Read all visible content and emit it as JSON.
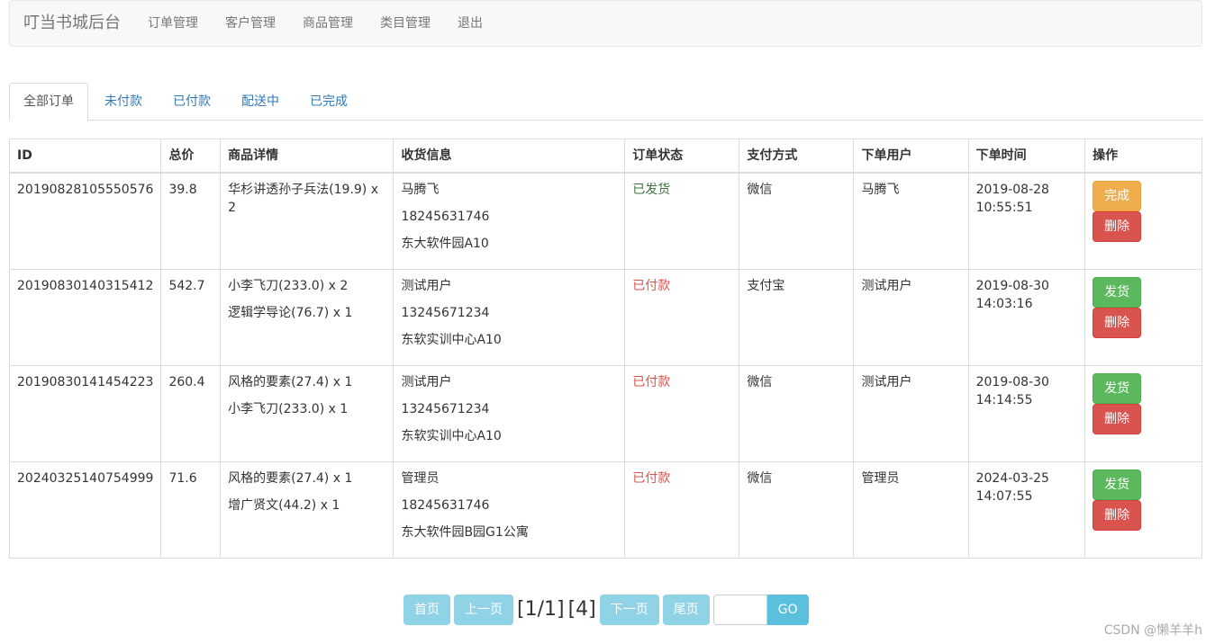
{
  "navbar": {
    "brand": "叮当书城后台",
    "links": [
      "订单管理",
      "客户管理",
      "商品管理",
      "类目管理",
      "退出"
    ]
  },
  "tabs": [
    "全部订单",
    "未付款",
    "已付款",
    "配送中",
    "已完成"
  ],
  "table": {
    "headers": [
      "ID",
      "总价",
      "商品详情",
      "收货信息",
      "订单状态",
      "支付方式",
      "下单用户",
      "下单时间",
      "操作"
    ],
    "rows": [
      {
        "id": "20190828105550576",
        "total": "39.8",
        "items": [
          "华杉讲透孙子兵法(19.9) x 2"
        ],
        "address": [
          "马腾飞",
          "18245631746",
          "东大软件园A10"
        ],
        "status": "已发货",
        "payment": "微信",
        "user": "马腾飞",
        "time": [
          "2019-08-28",
          "10:55:51"
        ],
        "action": "完成",
        "delete": "删除"
      },
      {
        "id": "20190830140315412",
        "total": "542.7",
        "items": [
          "小李飞刀(233.0) x 2",
          "逻辑学导论(76.7) x 1"
        ],
        "address": [
          "测试用户",
          "13245671234",
          "东软实训中心A10"
        ],
        "status": "已付款",
        "payment": "支付宝",
        "user": "测试用户",
        "time": [
          "2019-08-30",
          "14:03:16"
        ],
        "action": "发货",
        "delete": "删除"
      },
      {
        "id": "20190830141454223",
        "total": "260.4",
        "items": [
          "风格的要素(27.4) x 1",
          "小李飞刀(233.0) x 1"
        ],
        "address": [
          "测试用户",
          "13245671234",
          "东软实训中心A10"
        ],
        "status": "已付款",
        "payment": "微信",
        "user": "测试用户",
        "time": [
          "2019-08-30",
          "14:14:55"
        ],
        "action": "发货",
        "delete": "删除"
      },
      {
        "id": "20240325140754999",
        "total": "71.6",
        "items": [
          "风格的要素(27.4) x 1",
          "增广贤文(44.2) x 1"
        ],
        "address": [
          "管理员",
          "18245631746",
          "东大软件园B园G1公寓"
        ],
        "status": "已付款",
        "payment": "微信",
        "user": "管理员",
        "time": [
          "2024-03-25",
          "14:07:55"
        ],
        "action": "发货",
        "delete": "删除"
      }
    ]
  },
  "pager": {
    "first": "首页",
    "prev": "上一页",
    "page_info": "[1/1]",
    "count_info": "[4]",
    "next": "下一页",
    "last": "尾页",
    "input_value": "",
    "go": "GO"
  },
  "watermark": "CSDN @懒羊羊h"
}
